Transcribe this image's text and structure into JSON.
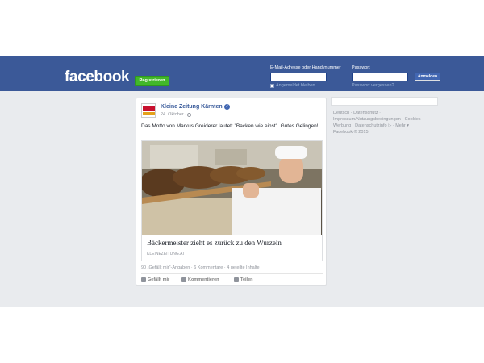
{
  "header": {
    "logo": "facebook",
    "register_label": "Registrieren",
    "email_label": "E-Mail-Adresse oder Handynummer",
    "password_label": "Passwort",
    "login_label": "Anmelden",
    "remember_label": "Angemeldet bleiben",
    "forgot_label": "Passwort vergessen?"
  },
  "post": {
    "page_name": "Kleine Zeitung Kärnten",
    "date": "24. Oktober · ",
    "text": "Das Motto von Markus Greiderer lautet: \"Backen wie einst\". Gutes Gelingen!",
    "link": {
      "title": "Bäckermeister zieht es zurück zu den Wurzeln",
      "domain": "KLEINEZEITUNG.AT"
    },
    "stats": "90 „Gefällt mir\"-Angaben · 6 Kommentare · 4 geteilte Inhalte",
    "actions": {
      "like": "Gefällt mir",
      "comment": "Kommentieren",
      "share": "Teilen"
    }
  },
  "footer": {
    "links": "Deutsch · Datenschutz · Impressum/Nutzungsbedingungen · Cookies · Werbung · Datenschutzinfo ▷ · Mehr ▾",
    "copyright": "Facebook © 2015"
  },
  "colors": {
    "brand_blue": "#3b5998",
    "register_green": "#42b72a",
    "background_grey": "#e9ebee",
    "link_blue": "#365899"
  },
  "icons": {
    "verified": "verified-badge-icon",
    "globe": "globe-icon",
    "like": "thumbs-up-icon",
    "comment": "comment-icon",
    "share": "share-arrow-icon"
  }
}
